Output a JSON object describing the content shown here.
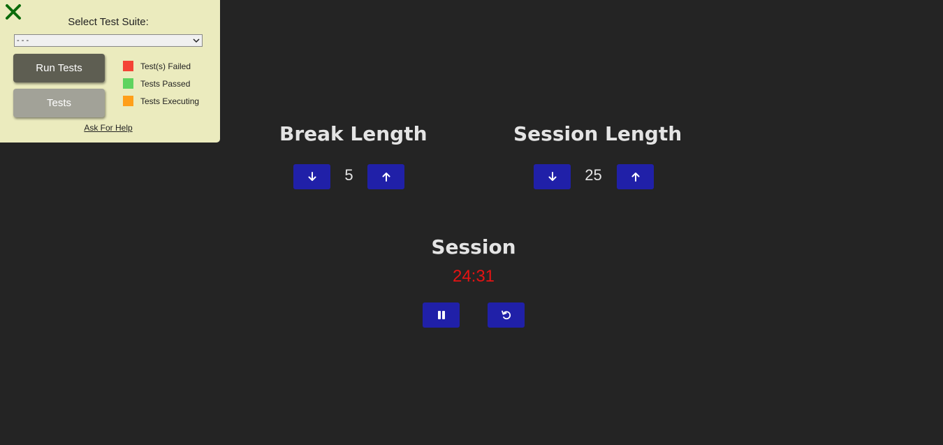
{
  "test_panel": {
    "suite_label": "Select Test Suite:",
    "suite_selected": "- - -",
    "run_button": "Run Tests",
    "tests_button": "Tests",
    "legend": [
      {
        "label": "Test(s) Failed",
        "color": "#f44336"
      },
      {
        "label": "Tests Passed",
        "color": "#5fd35f"
      },
      {
        "label": "Tests Executing",
        "color": "#ff9f1a"
      }
    ],
    "help_link": "Ask For Help",
    "close_icon": "close-x-icon",
    "close_color": "#0b6b0b"
  },
  "break": {
    "title": "Break Length",
    "value": "5",
    "decrement_icon": "arrow-down-icon",
    "increment_icon": "arrow-up-icon"
  },
  "session": {
    "title": "Session Length",
    "value": "25",
    "decrement_icon": "arrow-down-icon",
    "increment_icon": "arrow-up-icon"
  },
  "timer": {
    "label": "Session",
    "time_left": "24:31",
    "time_color": "#e51313",
    "pause_icon": "pause-icon",
    "reset_icon": "reset-icon"
  },
  "colors": {
    "background": "#242424",
    "button": "#2020a8",
    "panel": "#ebebbe"
  }
}
